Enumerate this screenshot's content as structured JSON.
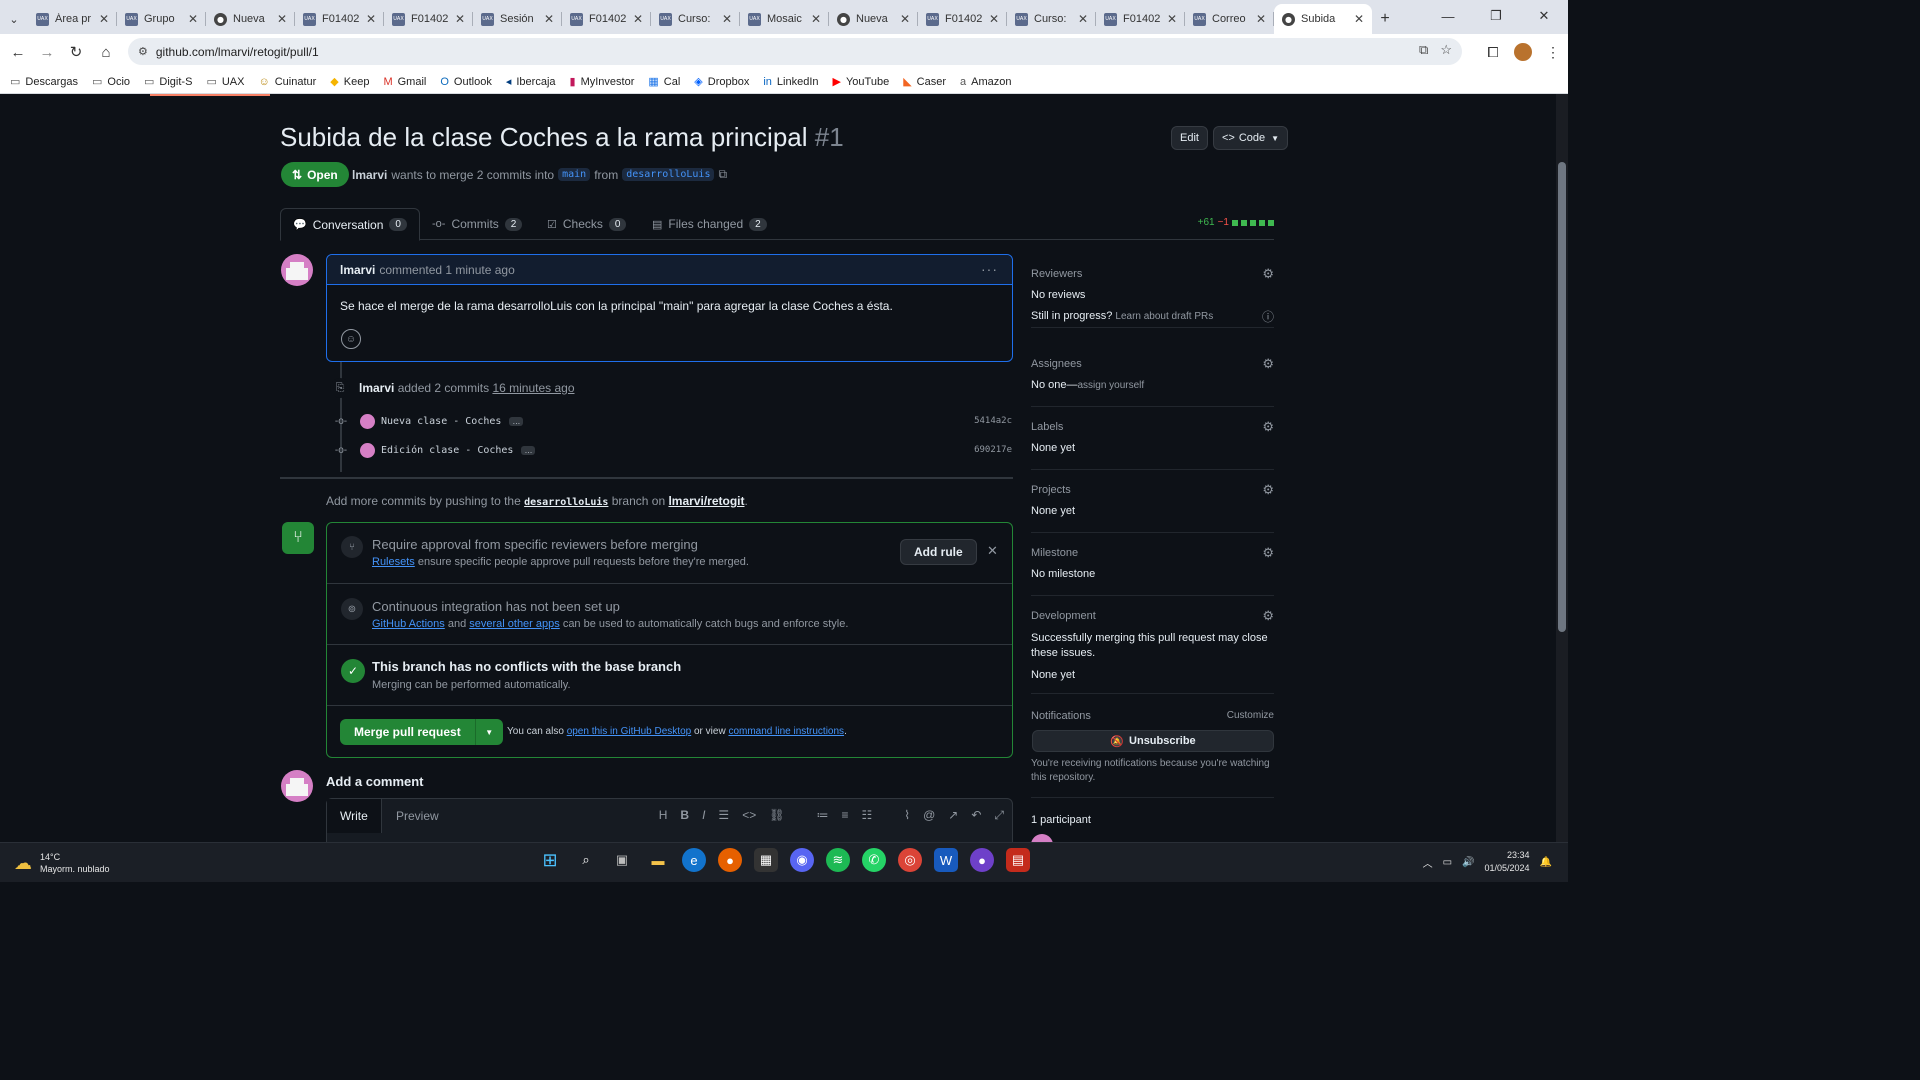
{
  "browser": {
    "tabs": [
      {
        "title": "Área pr",
        "favicon": "UAX"
      },
      {
        "title": "Grupo",
        "favicon": "UAX"
      },
      {
        "title": "Nueva",
        "favicon": "github"
      },
      {
        "title": "F01402",
        "favicon": "UAX"
      },
      {
        "title": "F01402",
        "favicon": "UAX"
      },
      {
        "title": "Sesión",
        "favicon": "UAX"
      },
      {
        "title": "F01402",
        "favicon": "UAX"
      },
      {
        "title": "Curso:",
        "favicon": "UAX"
      },
      {
        "title": "Mosaic",
        "favicon": "UAX"
      },
      {
        "title": "Nueva",
        "favicon": "github"
      },
      {
        "title": "F01402",
        "favicon": "UAX"
      },
      {
        "title": "Curso:",
        "favicon": "UAX"
      },
      {
        "title": "F01402",
        "favicon": "UAX"
      },
      {
        "title": "Correo",
        "favicon": "UAX"
      }
    ],
    "active_tab": {
      "title": "Subida",
      "favicon": "github"
    },
    "url": "github.com/lmarvi/retogit/pull/1",
    "bookmarks": [
      {
        "label": "Descargas",
        "icon": "folder-icon"
      },
      {
        "label": "Ocio",
        "icon": "folder-icon"
      },
      {
        "label": "Digit-S",
        "icon": "folder-icon"
      },
      {
        "label": "UAX",
        "icon": "folder-icon"
      },
      {
        "label": "Cuinatur",
        "icon": "cuinatur-icon"
      },
      {
        "label": "Keep",
        "icon": "keep-icon"
      },
      {
        "label": "Gmail",
        "icon": "gmail-icon"
      },
      {
        "label": "Outlook",
        "icon": "outlook-icon"
      },
      {
        "label": "Ibercaja",
        "icon": "ibercaja-icon"
      },
      {
        "label": "MyInvestor",
        "icon": "myinvestor-icon"
      },
      {
        "label": "Cal",
        "icon": "calendar-icon"
      },
      {
        "label": "Dropbox",
        "icon": "dropbox-icon"
      },
      {
        "label": "LinkedIn",
        "icon": "linkedin-icon"
      },
      {
        "label": "YouTube",
        "icon": "youtube-icon"
      },
      {
        "label": "Caser",
        "icon": "caser-icon"
      },
      {
        "label": "Amazon",
        "icon": "amazon-icon"
      }
    ]
  },
  "pr": {
    "title": "Subida de la clase Coches a la rama principal",
    "number": "#1",
    "edit_label": "Edit",
    "code_label": "Code",
    "state": "Open",
    "author": "lmarvi",
    "meta_text": "wants to merge 2 commits into",
    "base_branch": "main",
    "from_text": "from",
    "head_branch": "desarrolloLuis",
    "tabs": [
      {
        "label": "Conversation",
        "count": "0"
      },
      {
        "label": "Commits",
        "count": "2"
      },
      {
        "label": "Checks",
        "count": "0"
      },
      {
        "label": "Files changed",
        "count": "2"
      }
    ],
    "additions": "+61",
    "deletions": "−1",
    "comment": {
      "author": "lmarvi",
      "action": "commented 1 minute ago",
      "body": "Se hace el merge de la rama desarrolloLuis con la principal \"main\" para agregar la clase Coches a ésta."
    },
    "commits_event": {
      "author": "lmarvi",
      "action": "added 2 commits",
      "time": "16 minutes ago"
    },
    "commits": [
      {
        "message": "Nueva clase - Coches",
        "sha": "5414a2c"
      },
      {
        "message": "Edición clase - Coches",
        "sha": "690217e"
      }
    ],
    "push_hint": {
      "before": "Add more commits by pushing to the",
      "branch": "desarrolloLuis",
      "middle": "branch on",
      "repo": "lmarvi/retogit",
      "after": "."
    },
    "merge": {
      "rule_title": "Require approval from specific reviewers before merging",
      "rule_link": "Rulesets",
      "rule_text": "ensure specific people approve pull requests before they're merged.",
      "add_rule_label": "Add rule",
      "ci_title": "Continuous integration has not been set up",
      "ci_link1": "GitHub Actions",
      "ci_and": "and",
      "ci_link2": "several other apps",
      "ci_text": "can be used to automatically catch bugs and enforce style.",
      "conflict_title": "This branch has no conflicts with the base branch",
      "conflict_text": "Merging can be performed automatically.",
      "merge_button": "Merge pull request",
      "also_text": "You can also",
      "also_link1": "open this in GitHub Desktop",
      "also_or": "or view",
      "also_link2": "command line instructions",
      "also_end": "."
    },
    "add_comment": {
      "title": "Add a comment",
      "write_tab": "Write",
      "preview_tab": "Preview"
    }
  },
  "sidebar": {
    "reviewers": {
      "title": "Reviewers",
      "value": "No reviews",
      "progress_label": "Still in progress?",
      "progress_link": "Learn about draft PRs"
    },
    "assignees": {
      "title": "Assignees",
      "value": "No one—",
      "link": "assign yourself"
    },
    "labels": {
      "title": "Labels",
      "value": "None yet"
    },
    "projects": {
      "title": "Projects",
      "value": "None yet"
    },
    "milestone": {
      "title": "Milestone",
      "value": "No milestone"
    },
    "development": {
      "title": "Development",
      "text": "Successfully merging this pull request may close these issues.",
      "value": "None yet"
    },
    "notifications": {
      "title": "Notifications",
      "customize": "Customize",
      "unsubscribe": "Unsubscribe",
      "text": "You're receiving notifications because you're watching this repository."
    },
    "participants": {
      "title": "1 participant"
    }
  },
  "taskbar": {
    "temperature": "14°C",
    "weather": "Mayorm. nublado",
    "time": "23:34",
    "date": "01/05/2024"
  }
}
